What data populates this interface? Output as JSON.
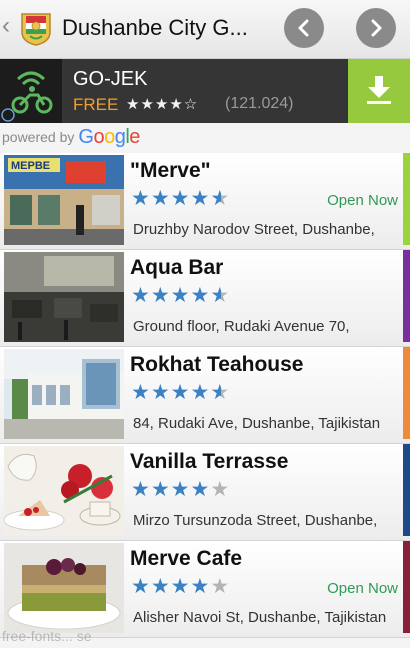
{
  "appbar": {
    "title": "Dushanbe City G...",
    "back_icon": "back-chevron-icon",
    "prev_icon": "chevron-left-icon",
    "next_icon": "chevron-right-icon"
  },
  "ad": {
    "name": "GO-JEK",
    "price": "FREE",
    "stars": "★★★★☆",
    "rating_count": "(121.024)",
    "download_icon": "download-icon",
    "accent": "#96c93d",
    "price_color": "#f0a02a"
  },
  "powered": {
    "prefix": "powered by",
    "brand": [
      "G",
      "o",
      "o",
      "g",
      "l",
      "e"
    ]
  },
  "places": [
    {
      "name": "\"Merve\"",
      "rating_stars": 4.5,
      "status": "Open Now",
      "address": "Druzhby Narodov Street, Dushanbe,",
      "strip_color": "#9bd43a"
    },
    {
      "name": "Aqua Bar",
      "rating_stars": 4.5,
      "status": "",
      "address": "Ground floor, Rudaki Avenue 70,",
      "strip_color": "#7a2f9e"
    },
    {
      "name": "Rokhat Teahouse",
      "rating_stars": 4.5,
      "status": "",
      "address": "84, Rudaki Ave, Dushanbe, Tajikistan",
      "strip_color": "#f08a3a"
    },
    {
      "name": "Vanilla Terrasse",
      "rating_stars": 4,
      "status": "",
      "address": "Mirzo Tursunzoda Street, Dushanbe,",
      "strip_color": "#1f4a8a"
    },
    {
      "name": "Merve Cafe",
      "rating_stars": 4,
      "status": "Open Now",
      "address": "Alisher Navoi St, Dushanbe, Tajikistan",
      "strip_color": "#8a1f3a"
    }
  ],
  "watermark": "free-fonts... se"
}
